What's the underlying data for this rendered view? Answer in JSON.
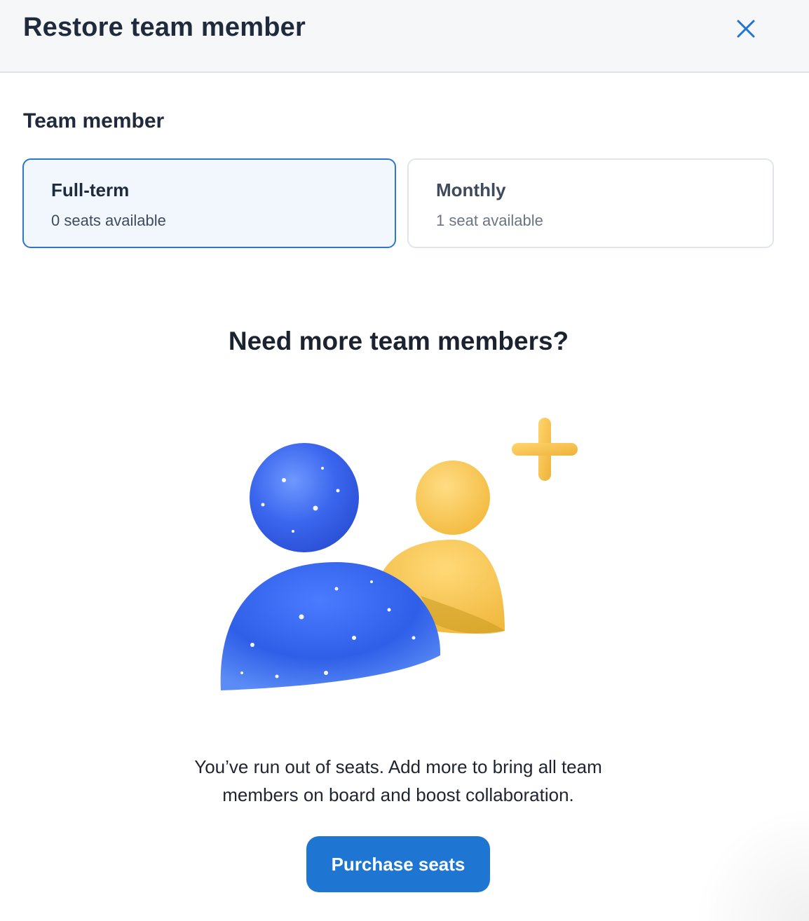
{
  "header": {
    "title": "Restore team member",
    "close_icon": "close-icon"
  },
  "team_member": {
    "label": "Team member",
    "options": [
      {
        "name": "Full-term",
        "seats": "0 seats available",
        "selected": true
      },
      {
        "name": "Monthly",
        "seats": "1 seat available",
        "selected": false
      }
    ]
  },
  "upsell": {
    "heading": "Need more team members?",
    "illustration_icon": "add-team-members-illustration",
    "description": "You’ve run out of seats. Add more to bring all team members on board and boost collaboration.",
    "button_label": "Purchase seats"
  },
  "colors": {
    "accent": "#1f76d2",
    "selected_border": "#2d77c9",
    "selected_bg": "#f2f7fd",
    "header_bg": "#f6f7f9",
    "person_blue": "#3a6cf0",
    "person_yellow": "#f6c24a",
    "plus_yellow": "#f2be3f"
  }
}
